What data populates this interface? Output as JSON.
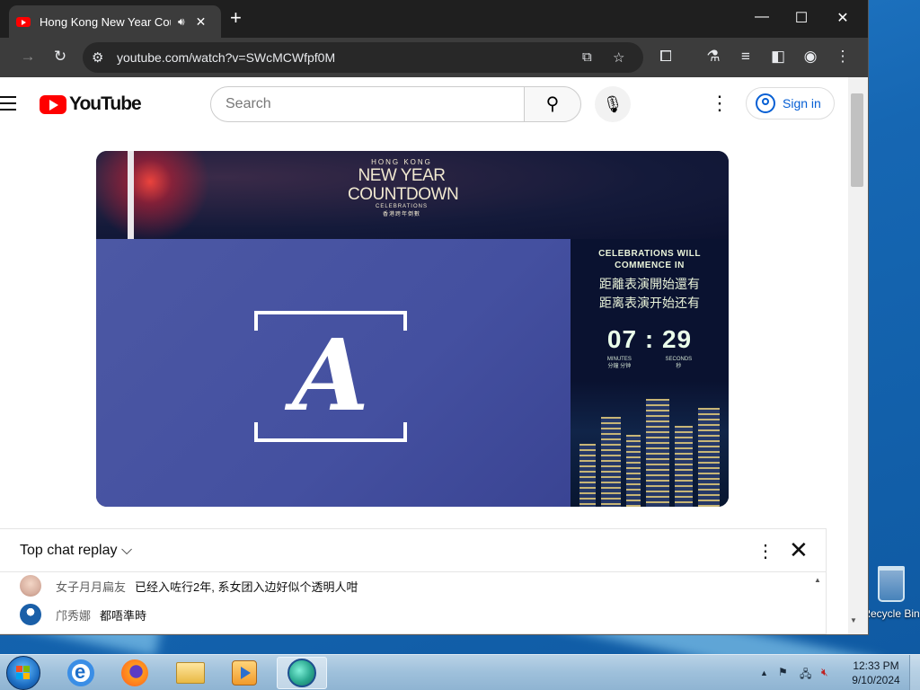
{
  "browser": {
    "tab_title": "Hong Kong New Year Countdown",
    "tab_audio_icon": "speaker-icon",
    "url": "youtube.com/watch?v=SWcMCWfpf0M"
  },
  "youtube": {
    "logo_text": "YouTube",
    "search_placeholder": "Search",
    "sign_in": "Sign in"
  },
  "video": {
    "brand_small": "HONG KONG",
    "brand_line1": "NEW YEAR",
    "brand_line2": "COUNTDOWN",
    "brand_sub": "CELEBRATIONS",
    "brand_cn": "香港跨年倒數",
    "countdown_en_1": "CELEBRATIONS WILL",
    "countdown_en_2": "COMMENCE IN",
    "countdown_cn_1": "距離表演開始還有",
    "countdown_cn_2": "距离表演开始还有",
    "minutes": "07",
    "separator": ":",
    "seconds": "29",
    "minutes_label": "MINUTES",
    "minutes_label_cn": "分鐘 分钟",
    "seconds_label": "SECONDS",
    "seconds_label_cn": "秒"
  },
  "chat": {
    "title": "Top chat replay",
    "messages": [
      {
        "author": "女子月月扁友",
        "text": "已经入咗行2年, 系女团入边好似个透明人咁"
      },
      {
        "author": "邝秀娜",
        "text": "都唔準時"
      }
    ]
  },
  "desktop": {
    "recycle_bin_label": "Recycle Bin"
  },
  "taskbar": {
    "time": "12:33 PM",
    "date": "9/10/2024"
  },
  "colors": {
    "youtube_red": "#ff0000",
    "link_blue": "#065fd4",
    "chrome_dark": "#1f1f1f"
  }
}
